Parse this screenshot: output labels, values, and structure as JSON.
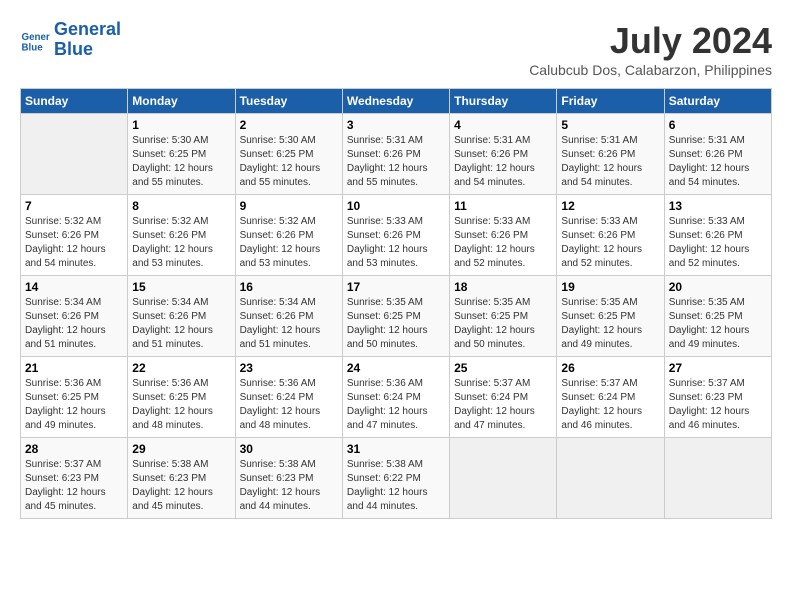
{
  "header": {
    "logo_line1": "General",
    "logo_line2": "Blue",
    "month_title": "July 2024",
    "location": "Calubcub Dos, Calabarzon, Philippines"
  },
  "days_of_week": [
    "Sunday",
    "Monday",
    "Tuesday",
    "Wednesday",
    "Thursday",
    "Friday",
    "Saturday"
  ],
  "weeks": [
    [
      {
        "day": "",
        "sunrise": "",
        "sunset": "",
        "daylight": ""
      },
      {
        "day": "1",
        "sunrise": "Sunrise: 5:30 AM",
        "sunset": "Sunset: 6:25 PM",
        "daylight": "Daylight: 12 hours and 55 minutes."
      },
      {
        "day": "2",
        "sunrise": "Sunrise: 5:30 AM",
        "sunset": "Sunset: 6:25 PM",
        "daylight": "Daylight: 12 hours and 55 minutes."
      },
      {
        "day": "3",
        "sunrise": "Sunrise: 5:31 AM",
        "sunset": "Sunset: 6:26 PM",
        "daylight": "Daylight: 12 hours and 55 minutes."
      },
      {
        "day": "4",
        "sunrise": "Sunrise: 5:31 AM",
        "sunset": "Sunset: 6:26 PM",
        "daylight": "Daylight: 12 hours and 54 minutes."
      },
      {
        "day": "5",
        "sunrise": "Sunrise: 5:31 AM",
        "sunset": "Sunset: 6:26 PM",
        "daylight": "Daylight: 12 hours and 54 minutes."
      },
      {
        "day": "6",
        "sunrise": "Sunrise: 5:31 AM",
        "sunset": "Sunset: 6:26 PM",
        "daylight": "Daylight: 12 hours and 54 minutes."
      }
    ],
    [
      {
        "day": "7",
        "sunrise": "Sunrise: 5:32 AM",
        "sunset": "Sunset: 6:26 PM",
        "daylight": "Daylight: 12 hours and 54 minutes."
      },
      {
        "day": "8",
        "sunrise": "Sunrise: 5:32 AM",
        "sunset": "Sunset: 6:26 PM",
        "daylight": "Daylight: 12 hours and 53 minutes."
      },
      {
        "day": "9",
        "sunrise": "Sunrise: 5:32 AM",
        "sunset": "Sunset: 6:26 PM",
        "daylight": "Daylight: 12 hours and 53 minutes."
      },
      {
        "day": "10",
        "sunrise": "Sunrise: 5:33 AM",
        "sunset": "Sunset: 6:26 PM",
        "daylight": "Daylight: 12 hours and 53 minutes."
      },
      {
        "day": "11",
        "sunrise": "Sunrise: 5:33 AM",
        "sunset": "Sunset: 6:26 PM",
        "daylight": "Daylight: 12 hours and 52 minutes."
      },
      {
        "day": "12",
        "sunrise": "Sunrise: 5:33 AM",
        "sunset": "Sunset: 6:26 PM",
        "daylight": "Daylight: 12 hours and 52 minutes."
      },
      {
        "day": "13",
        "sunrise": "Sunrise: 5:33 AM",
        "sunset": "Sunset: 6:26 PM",
        "daylight": "Daylight: 12 hours and 52 minutes."
      }
    ],
    [
      {
        "day": "14",
        "sunrise": "Sunrise: 5:34 AM",
        "sunset": "Sunset: 6:26 PM",
        "daylight": "Daylight: 12 hours and 51 minutes."
      },
      {
        "day": "15",
        "sunrise": "Sunrise: 5:34 AM",
        "sunset": "Sunset: 6:26 PM",
        "daylight": "Daylight: 12 hours and 51 minutes."
      },
      {
        "day": "16",
        "sunrise": "Sunrise: 5:34 AM",
        "sunset": "Sunset: 6:26 PM",
        "daylight": "Daylight: 12 hours and 51 minutes."
      },
      {
        "day": "17",
        "sunrise": "Sunrise: 5:35 AM",
        "sunset": "Sunset: 6:25 PM",
        "daylight": "Daylight: 12 hours and 50 minutes."
      },
      {
        "day": "18",
        "sunrise": "Sunrise: 5:35 AM",
        "sunset": "Sunset: 6:25 PM",
        "daylight": "Daylight: 12 hours and 50 minutes."
      },
      {
        "day": "19",
        "sunrise": "Sunrise: 5:35 AM",
        "sunset": "Sunset: 6:25 PM",
        "daylight": "Daylight: 12 hours and 49 minutes."
      },
      {
        "day": "20",
        "sunrise": "Sunrise: 5:35 AM",
        "sunset": "Sunset: 6:25 PM",
        "daylight": "Daylight: 12 hours and 49 minutes."
      }
    ],
    [
      {
        "day": "21",
        "sunrise": "Sunrise: 5:36 AM",
        "sunset": "Sunset: 6:25 PM",
        "daylight": "Daylight: 12 hours and 49 minutes."
      },
      {
        "day": "22",
        "sunrise": "Sunrise: 5:36 AM",
        "sunset": "Sunset: 6:25 PM",
        "daylight": "Daylight: 12 hours and 48 minutes."
      },
      {
        "day": "23",
        "sunrise": "Sunrise: 5:36 AM",
        "sunset": "Sunset: 6:24 PM",
        "daylight": "Daylight: 12 hours and 48 minutes."
      },
      {
        "day": "24",
        "sunrise": "Sunrise: 5:36 AM",
        "sunset": "Sunset: 6:24 PM",
        "daylight": "Daylight: 12 hours and 47 minutes."
      },
      {
        "day": "25",
        "sunrise": "Sunrise: 5:37 AM",
        "sunset": "Sunset: 6:24 PM",
        "daylight": "Daylight: 12 hours and 47 minutes."
      },
      {
        "day": "26",
        "sunrise": "Sunrise: 5:37 AM",
        "sunset": "Sunset: 6:24 PM",
        "daylight": "Daylight: 12 hours and 46 minutes."
      },
      {
        "day": "27",
        "sunrise": "Sunrise: 5:37 AM",
        "sunset": "Sunset: 6:23 PM",
        "daylight": "Daylight: 12 hours and 46 minutes."
      }
    ],
    [
      {
        "day": "28",
        "sunrise": "Sunrise: 5:37 AM",
        "sunset": "Sunset: 6:23 PM",
        "daylight": "Daylight: 12 hours and 45 minutes."
      },
      {
        "day": "29",
        "sunrise": "Sunrise: 5:38 AM",
        "sunset": "Sunset: 6:23 PM",
        "daylight": "Daylight: 12 hours and 45 minutes."
      },
      {
        "day": "30",
        "sunrise": "Sunrise: 5:38 AM",
        "sunset": "Sunset: 6:23 PM",
        "daylight": "Daylight: 12 hours and 44 minutes."
      },
      {
        "day": "31",
        "sunrise": "Sunrise: 5:38 AM",
        "sunset": "Sunset: 6:22 PM",
        "daylight": "Daylight: 12 hours and 44 minutes."
      },
      {
        "day": "",
        "sunrise": "",
        "sunset": "",
        "daylight": ""
      },
      {
        "day": "",
        "sunrise": "",
        "sunset": "",
        "daylight": ""
      },
      {
        "day": "",
        "sunrise": "",
        "sunset": "",
        "daylight": ""
      }
    ]
  ]
}
